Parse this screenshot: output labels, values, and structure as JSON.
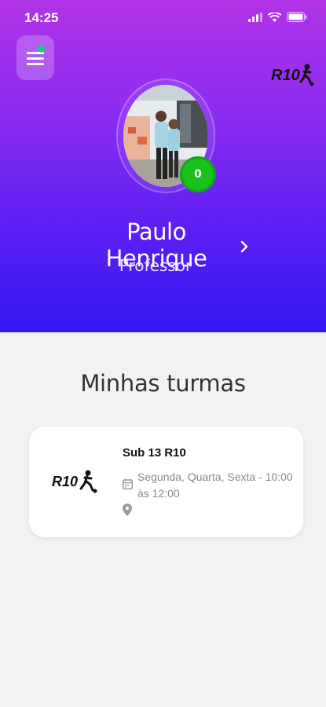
{
  "status_bar": {
    "time": "14:25"
  },
  "header": {
    "badge_count": "0",
    "user_name": "Paulo Henrique",
    "user_role": "Professor",
    "logo_text": "R10"
  },
  "section": {
    "title": "Minhas turmas"
  },
  "classes": [
    {
      "logo_text": "R10",
      "title": "Sub 13 R10",
      "schedule": "Segunda, Quarta, Sexta - 10:00 às 12:00",
      "location": ""
    }
  ],
  "colors": {
    "header_top": "#b233e8",
    "header_bottom": "#3418f2",
    "badge_green": "#17c21d",
    "notification_dot": "#15d36b"
  }
}
